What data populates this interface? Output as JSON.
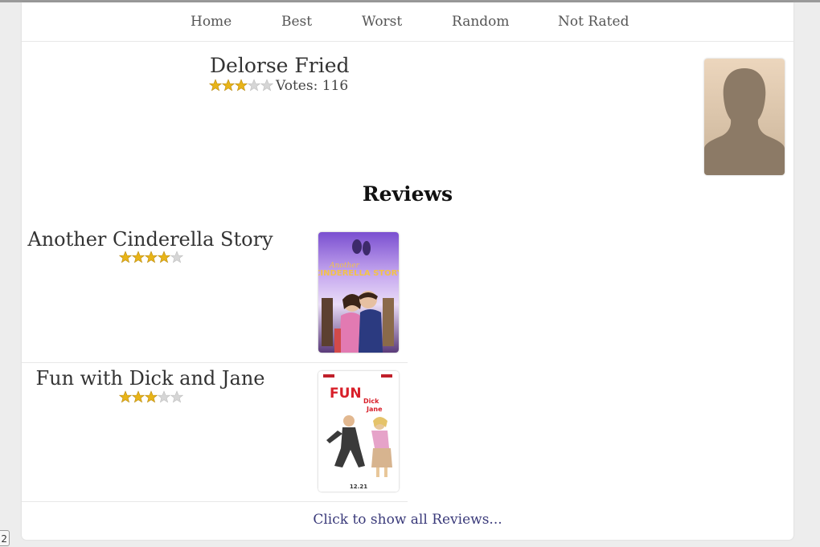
{
  "nav": {
    "items": [
      {
        "label": "Home"
      },
      {
        "label": "Best"
      },
      {
        "label": "Worst"
      },
      {
        "label": "Random"
      },
      {
        "label": "Not Rated"
      }
    ]
  },
  "person": {
    "name": "Delorse Fried",
    "rating_stars": 3,
    "rating_max": 5,
    "votes_text": "Votes: 116",
    "photo_icon": "person-silhouette-icon"
  },
  "reviews": {
    "heading": "Reviews",
    "items": [
      {
        "title": "Another Cinderella Story",
        "rating_stars": 4,
        "poster_text": [
          "Another",
          "CINDERELLA STORY"
        ]
      },
      {
        "title": "Fun with Dick and Jane",
        "rating_stars": 3,
        "poster_text": [
          "FUN",
          "Dick",
          "Jane",
          "12.21"
        ]
      }
    ],
    "show_all_label": "Click to show all Reviews..."
  },
  "corner_badge": "2",
  "colors": {
    "star_filled": "#e8b418",
    "star_empty": "#d6d6d6",
    "link": "#3a3a7a",
    "page_bg": "#ededed"
  }
}
